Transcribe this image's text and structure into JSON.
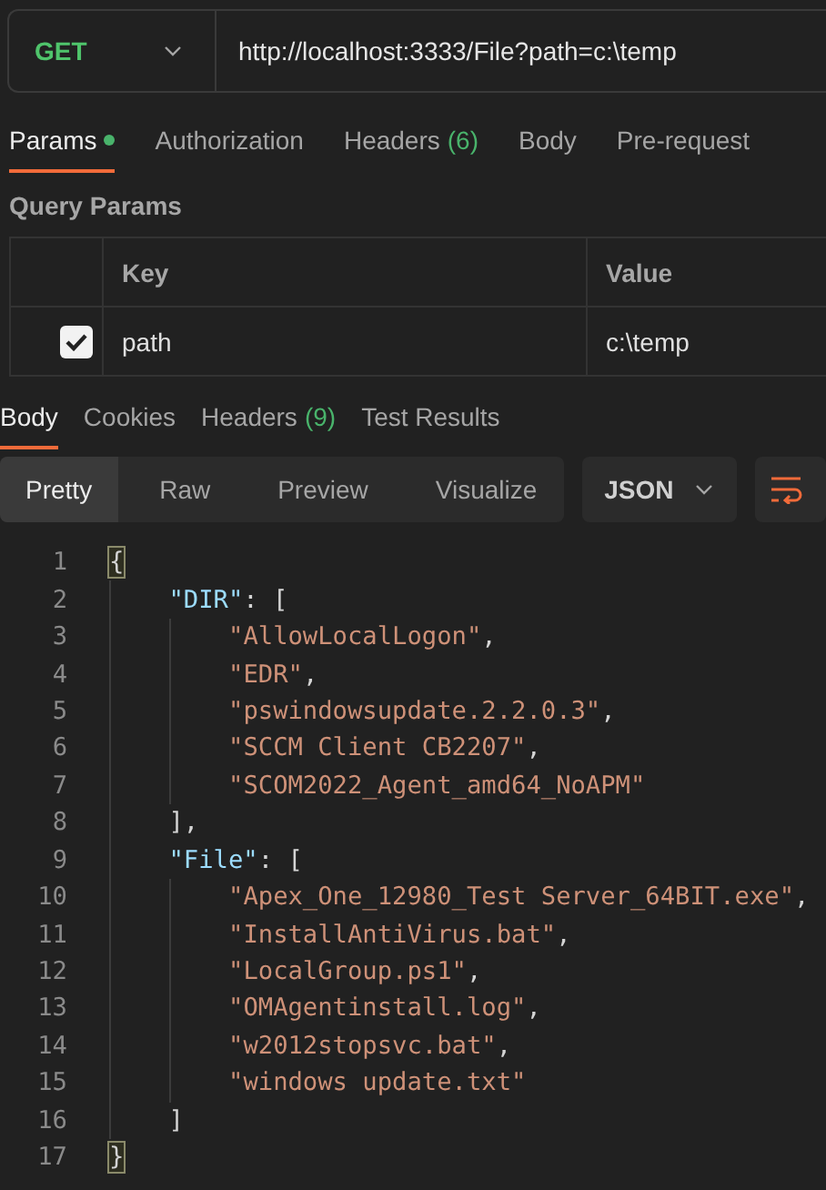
{
  "request": {
    "method": "GET",
    "url": "http://localhost:3333/File?path=c:\\temp"
  },
  "request_tabs": [
    {
      "label": "Params",
      "dot": true,
      "selected": true
    },
    {
      "label": "Authorization",
      "selected": false
    },
    {
      "label": "Headers",
      "count": "(6)",
      "selected": false
    },
    {
      "label": "Body",
      "selected": false
    },
    {
      "label": "Pre-request",
      "selected": false
    }
  ],
  "query_params": {
    "title": "Query Params",
    "columns": [
      "Key",
      "Value"
    ],
    "rows": [
      {
        "checked": true,
        "key": "path",
        "value": "c:\\temp"
      }
    ]
  },
  "response_tabs": [
    {
      "label": "Body",
      "selected": true
    },
    {
      "label": "Cookies",
      "selected": false
    },
    {
      "label": "Headers",
      "count": "(9)",
      "selected": false
    },
    {
      "label": "Test Results",
      "selected": false
    }
  ],
  "view_modes": [
    {
      "label": "Pretty",
      "selected": true
    },
    {
      "label": "Raw",
      "selected": false
    },
    {
      "label": "Preview",
      "selected": false
    },
    {
      "label": "Visualize",
      "selected": false
    }
  ],
  "format": "JSON",
  "code_lines": [
    {
      "number": "1",
      "tokens": [
        {
          "kind": "match",
          "text": "{"
        }
      ]
    },
    {
      "number": "2",
      "tokens": [
        {
          "kind": "key",
          "text": "\"DIR\""
        },
        {
          "kind": "punct",
          "text": ": ["
        }
      ]
    },
    {
      "number": "3",
      "tokens": [
        {
          "kind": "string",
          "text": "\"AllowLocalLogon\""
        },
        {
          "kind": "punct",
          "text": ","
        }
      ]
    },
    {
      "number": "4",
      "tokens": [
        {
          "kind": "string",
          "text": "\"EDR\""
        },
        {
          "kind": "punct",
          "text": ","
        }
      ]
    },
    {
      "number": "5",
      "tokens": [
        {
          "kind": "string",
          "text": "\"pswindowsupdate.2.2.0.3\""
        },
        {
          "kind": "punct",
          "text": ","
        }
      ]
    },
    {
      "number": "6",
      "tokens": [
        {
          "kind": "string",
          "text": "\"SCCM Client CB2207\""
        },
        {
          "kind": "punct",
          "text": ","
        }
      ]
    },
    {
      "number": "7",
      "tokens": [
        {
          "kind": "string",
          "text": "\"SCOM2022_Agent_amd64_NoAPM\""
        }
      ]
    },
    {
      "number": "8",
      "tokens": [
        {
          "kind": "punct",
          "text": "],"
        }
      ]
    },
    {
      "number": "9",
      "tokens": [
        {
          "kind": "key",
          "text": "\"File\""
        },
        {
          "kind": "punct",
          "text": ": ["
        }
      ]
    },
    {
      "number": "10",
      "tokens": [
        {
          "kind": "string",
          "text": "\"Apex_One_12980_Test Server_64BIT.exe\""
        },
        {
          "kind": "punct",
          "text": ","
        }
      ]
    },
    {
      "number": "11",
      "tokens": [
        {
          "kind": "string",
          "text": "\"InstallAntiVirus.bat\""
        },
        {
          "kind": "punct",
          "text": ","
        }
      ]
    },
    {
      "number": "12",
      "tokens": [
        {
          "kind": "string",
          "text": "\"LocalGroup.ps1\""
        },
        {
          "kind": "punct",
          "text": ","
        }
      ]
    },
    {
      "number": "13",
      "tokens": [
        {
          "kind": "string",
          "text": "\"OMAgentinstall.log\""
        },
        {
          "kind": "punct",
          "text": ","
        }
      ]
    },
    {
      "number": "14",
      "tokens": [
        {
          "kind": "string",
          "text": "\"w2012stopsvc.bat\""
        },
        {
          "kind": "punct",
          "text": ","
        }
      ]
    },
    {
      "number": "15",
      "tokens": [
        {
          "kind": "string",
          "text": "\"windows update.txt\""
        }
      ]
    },
    {
      "number": "16",
      "tokens": [
        {
          "kind": "punct",
          "text": "]"
        }
      ]
    },
    {
      "number": "17",
      "tokens": [
        {
          "kind": "match",
          "text": "}"
        }
      ]
    }
  ]
}
